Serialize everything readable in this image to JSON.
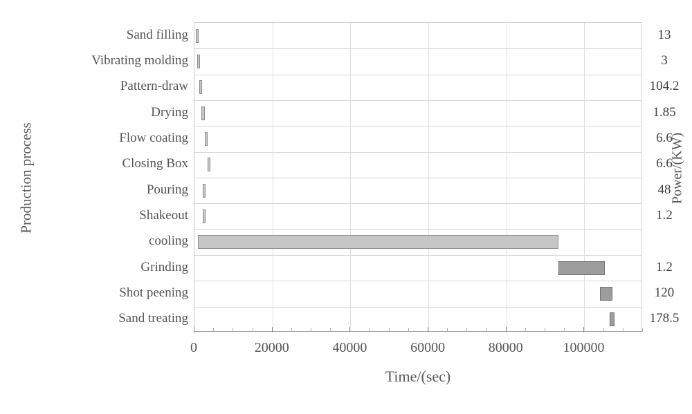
{
  "chart_data": {
    "type": "bar",
    "subtype": "gantt",
    "title": "",
    "xlabel": "Time/(sec)",
    "ylabel": "Production process",
    "right_axis_label": "Power/(KW)",
    "xlim": [
      0,
      115000
    ],
    "xticks": [
      0,
      20000,
      40000,
      60000,
      80000,
      100000
    ],
    "xtick_labels": [
      "0",
      "20000",
      "40000",
      "60000",
      "80000",
      "100000"
    ],
    "minor_tick_step": 5000,
    "grid": "both",
    "legend": "none",
    "bar_color": "#c6c6c6",
    "bar_edge_color": "#8d8d8d",
    "categories": [
      "Sand filling",
      "Vibrating molding",
      "Pattern-draw",
      "Drying",
      "Flow coating",
      "Closing Box",
      "Pouring",
      "Shakeout",
      "cooling",
      "Grinding",
      "Shot peening",
      "Sand treating"
    ],
    "power_values": [
      "13",
      "3",
      "104.2",
      "1.85",
      "6.6",
      "6.6",
      "48",
      "1.2",
      "",
      "1.2",
      "120",
      "178.5"
    ],
    "bars": [
      {
        "category": "Sand filling",
        "start": 300,
        "duration": 420,
        "power": "13"
      },
      {
        "category": "Vibrating molding",
        "start": 720,
        "duration": 520,
        "power": "3"
      },
      {
        "category": "Pattern-draw",
        "start": 1240,
        "duration": 620,
        "power": "104.2"
      },
      {
        "category": "Drying",
        "start": 1860,
        "duration": 880,
        "power": "1.85"
      },
      {
        "category": "Flow coating",
        "start": 2740,
        "duration": 700,
        "power": "6.6"
      },
      {
        "category": "Closing Box",
        "start": 3440,
        "duration": 700,
        "power": "6.6"
      },
      {
        "category": "Pouring",
        "start": 2100,
        "duration": 700,
        "power": "48"
      },
      {
        "category": "Shakeout",
        "start": 2100,
        "duration": 700,
        "power": "1.2"
      },
      {
        "category": "cooling",
        "start": 900,
        "duration": 92500,
        "power": ""
      },
      {
        "category": "Grinding",
        "start": 93300,
        "duration": 12000,
        "power": "1.2"
      },
      {
        "category": "Shot peening",
        "start": 104000,
        "duration": 3200,
        "power": "120"
      },
      {
        "category": "Sand treating",
        "start": 106500,
        "duration": 1300,
        "power": "178.5"
      }
    ]
  }
}
